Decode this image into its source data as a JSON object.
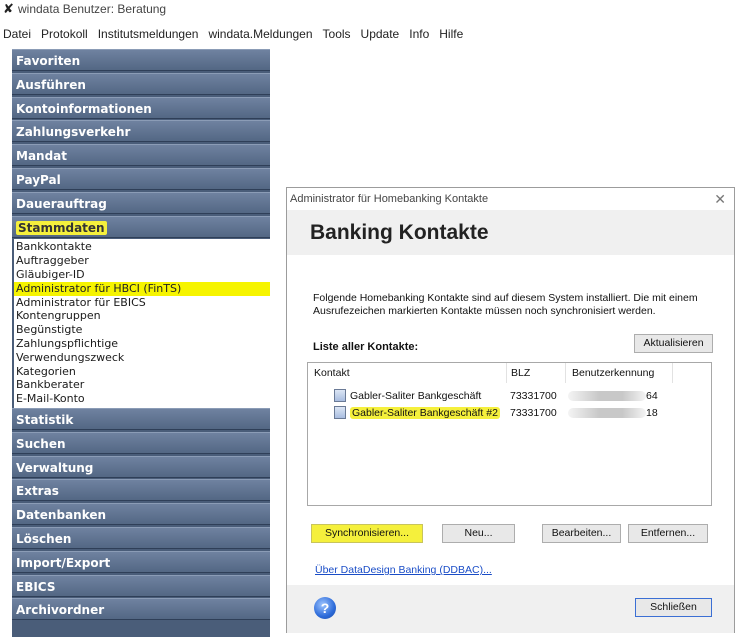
{
  "window": {
    "title": "windata Benutzer: Beratung",
    "app_icon": "windata-icon"
  },
  "menubar": [
    "Datei",
    "Protokoll",
    "Institutsmeldungen",
    "windata.Meldungen",
    "Tools",
    "Update",
    "Info",
    "Hilfe"
  ],
  "nav": {
    "headers_top": [
      "Favoriten",
      "Ausführen",
      "Kontoinformationen",
      "Zahlungsverkehr",
      "Mandat",
      "PayPal",
      "Dauerauftrag"
    ],
    "active_header": "Stammdaten",
    "sub_items": [
      "Bankkontakte",
      "Auftraggeber",
      "Gläubiger-ID",
      "Administrator für HBCI (FinTS)",
      "Administrator für EBICS",
      "Kontengruppen",
      "Begünstigte",
      "Zahlungspflichtige",
      "Verwendungszweck",
      "Kategorien",
      "Bankberater",
      "E-Mail-Konto"
    ],
    "selected_sub": "Administrator für HBCI (FinTS)",
    "headers_bottom": [
      "Statistik",
      "Suchen",
      "Verwaltung",
      "Extras",
      "Datenbanken",
      "Löschen",
      "Import/Export",
      "EBICS",
      "Archivordner"
    ]
  },
  "dialog": {
    "title": "Administrator für Homebanking Kontakte",
    "close": "✕",
    "heading": "Banking Kontakte",
    "intro": "Folgende Homebanking Kontakte sind auf diesem System installiert. Die mit einem Ausrufezeichen markierten Kontakte müssen noch synchronisiert werden.",
    "list_label": "Liste aller Kontakte:",
    "refresh_button": "Aktualisieren",
    "columns": [
      "Kontakt",
      "BLZ",
      "Benutzerkennung"
    ],
    "rows": [
      {
        "kontakt": "Gabler-Saliter Bankgeschäft",
        "blz": "73331700",
        "user_suffix": "64"
      },
      {
        "kontakt": "Gabler-Saliter Bankgeschäft #2",
        "blz": "73331700",
        "user_suffix": "18"
      }
    ],
    "buttons": {
      "sync": "Synchronisieren...",
      "new": "Neu...",
      "edit": "Bearbeiten...",
      "remove": "Entfernen..."
    },
    "link": "Über DataDesign Banking (DDBAC)...",
    "close_button": "Schließen",
    "help_icon": "?"
  },
  "colors": {
    "nav_bg": "#4a5d79",
    "highlight": "#f5f03c",
    "selection": "#f6f400"
  }
}
